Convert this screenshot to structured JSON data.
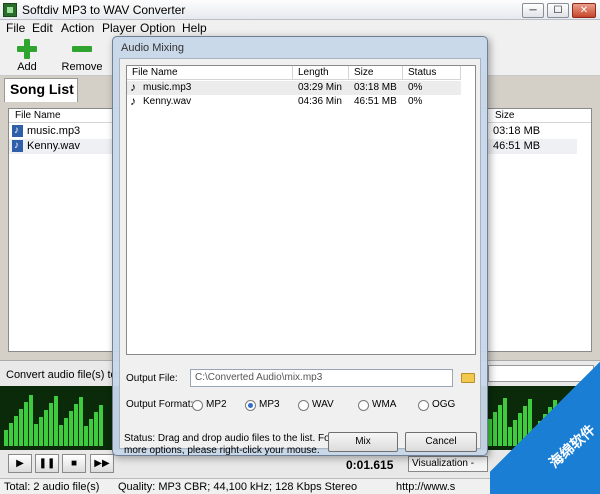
{
  "window": {
    "title": "Softdiv MP3 to WAV Converter",
    "min": "─",
    "max": "☐",
    "close": "✕"
  },
  "menu": [
    "File",
    "Edit",
    "Action",
    "Player",
    "Option",
    "Help"
  ],
  "toolbar": {
    "add_label": "Add",
    "remove_label": "Remove"
  },
  "song_list": {
    "tab_label": "Song List",
    "columns": {
      "file_name": "File Name",
      "size": "Size"
    },
    "rows": [
      {
        "name": "music.mp3",
        "size": "03:18 MB"
      },
      {
        "name": "Kenny.wav",
        "size": "46:51 MB"
      }
    ]
  },
  "convert": {
    "label": "Convert audio file(s) to:"
  },
  "player": {
    "time": "0:01.615",
    "visualization_label": "Visualization - ",
    "buttons": {
      "play": "▶",
      "pause": "❚❚",
      "stop": "■",
      "next": "▶▶",
      "prev": "◀◀"
    }
  },
  "status_bar": {
    "total": "Total: 2 audio file(s)",
    "quality": "Quality: MP3 CBR; 44,100 kHz; 128 Kbps Stereo",
    "url": "http://www.s"
  },
  "dialog": {
    "title": "Audio Mixing",
    "columns": {
      "file_name": "File Name",
      "length": "Length",
      "size": "Size",
      "status": "Status"
    },
    "rows": [
      {
        "name": "music.mp3",
        "length": "03:29 Min",
        "size": "03:18 MB",
        "status": "0%"
      },
      {
        "name": "Kenny.wav",
        "length": "04:36 Min",
        "size": "46:51 MB",
        "status": "0%"
      }
    ],
    "output_file_label": "Output File:",
    "output_file_value": "C:\\Converted Audio\\mix.mp3",
    "output_format_label": "Output Format:",
    "formats": [
      "MP2",
      "MP3",
      "WAV",
      "WMA",
      "OGG"
    ],
    "selected_format": "MP3",
    "status_text_1": "Status: Drag and drop audio files to the list. For",
    "status_text_2": "more options, please right-click your mouse.",
    "mix_label": "Mix",
    "cancel_label": "Cancel"
  },
  "watermark": {
    "text": "海绵软件"
  }
}
